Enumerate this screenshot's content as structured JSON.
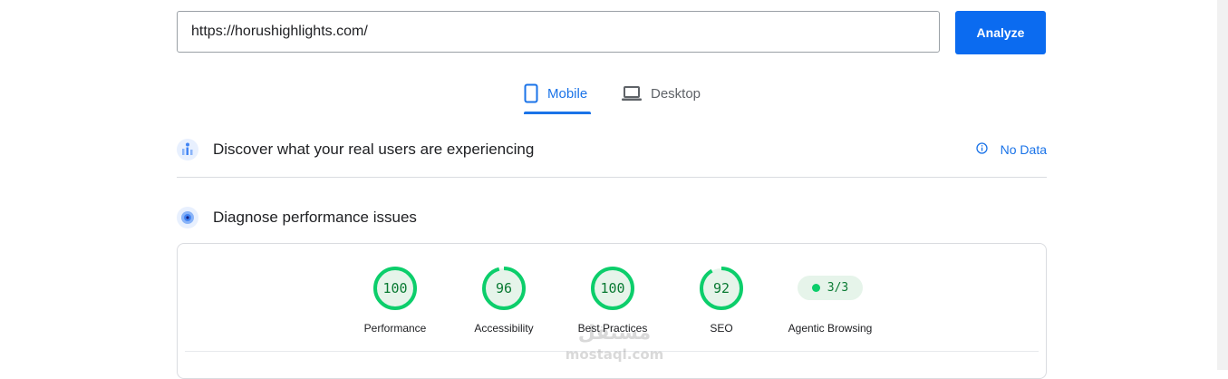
{
  "url_input": {
    "value": "https://horushighlights.com/"
  },
  "analyze_button": {
    "label": "Analyze"
  },
  "tabs": [
    {
      "label": "Mobile",
      "active": true
    },
    {
      "label": "Desktop",
      "active": false
    }
  ],
  "field_data": {
    "title": "Discover what your real users are experiencing",
    "status": "No Data"
  },
  "lab_data": {
    "title": "Diagnose performance issues"
  },
  "scores": [
    {
      "label": "Performance",
      "value": "100",
      "fraction": 1.0
    },
    {
      "label": "Accessibility",
      "value": "96",
      "fraction": 0.96
    },
    {
      "label": "Best Practices",
      "value": "100",
      "fraction": 1.0
    },
    {
      "label": "SEO",
      "value": "92",
      "fraction": 0.92
    }
  ],
  "agentic": {
    "label": "Agentic Browsing",
    "value": "3/3"
  },
  "colors": {
    "accent": "#1a73e8",
    "button": "#0b6bf0",
    "pass": "#0cce6b",
    "pass_text": "#0a7a33",
    "pass_bg": "#e6f4ea"
  },
  "watermark": {
    "text": "mostaql.com"
  }
}
